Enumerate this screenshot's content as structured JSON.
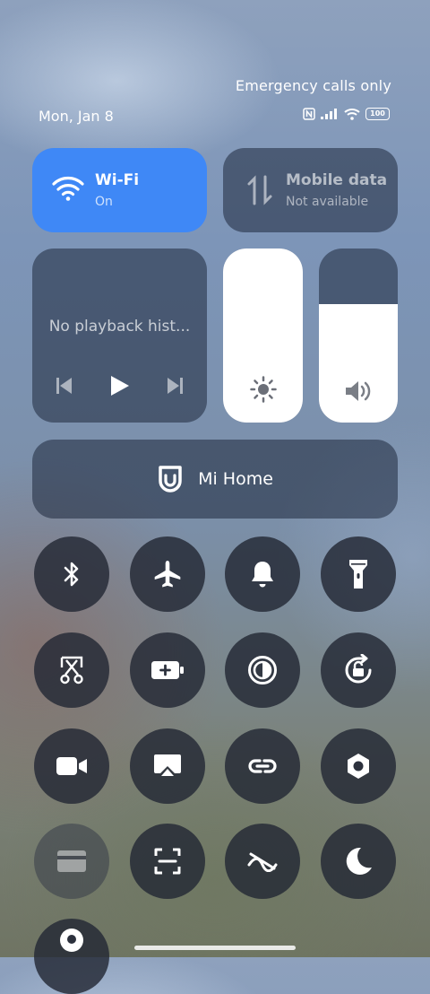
{
  "status": {
    "carrier_text": "Emergency calls only",
    "date": "Mon, Jan 8",
    "battery": "100"
  },
  "wifi": {
    "title": "Wi-Fi",
    "status": "On",
    "accent": "#3f88f6"
  },
  "mobile_data": {
    "title": "Mobile data",
    "status": "Not available"
  },
  "media": {
    "title": "No playback hist..."
  },
  "brightness": {
    "level": 1.0
  },
  "volume": {
    "level": 0.68
  },
  "mi_home": {
    "label": "Mi Home"
  },
  "toggles": [
    {
      "icon": "bluetooth-icon",
      "enabled": true
    },
    {
      "icon": "airplane-icon",
      "enabled": true
    },
    {
      "icon": "bell-icon",
      "enabled": true
    },
    {
      "icon": "flashlight-icon",
      "enabled": true
    },
    {
      "icon": "screenshot-scissors-icon",
      "enabled": true
    },
    {
      "icon": "battery-saver-icon",
      "enabled": true
    },
    {
      "icon": "reading-mode-icon",
      "enabled": true
    },
    {
      "icon": "rotation-lock-icon",
      "enabled": true
    },
    {
      "icon": "video-camera-icon",
      "enabled": true
    },
    {
      "icon": "cast-icon",
      "enabled": true
    },
    {
      "icon": "link-icon",
      "enabled": true
    },
    {
      "icon": "settings-nut-icon",
      "enabled": true
    },
    {
      "icon": "card-icon",
      "enabled": false
    },
    {
      "icon": "scan-icon",
      "enabled": true
    },
    {
      "icon": "data-saver-icon",
      "enabled": true
    },
    {
      "icon": "moon-icon",
      "enabled": true
    },
    {
      "icon": "location-icon",
      "enabled": true
    }
  ]
}
